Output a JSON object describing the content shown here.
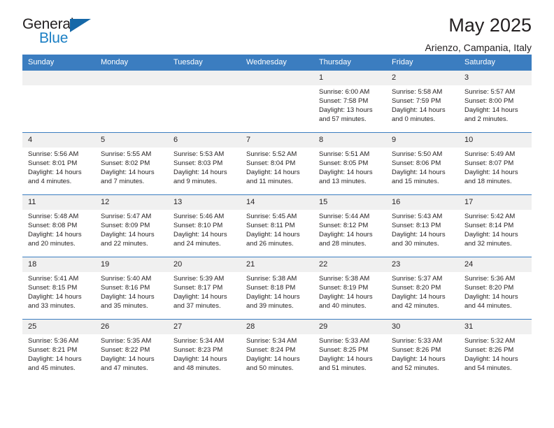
{
  "brand": {
    "name_top": "General",
    "name_bottom": "Blue",
    "accent_color": "#1b7fc4",
    "triangle_color": "#1568a8"
  },
  "header": {
    "title": "May 2025",
    "subtitle": "Arienzo, Campania, Italy"
  },
  "theme": {
    "header_row_bg": "#3b7dc0",
    "daynum_bg": "#f0f0f0",
    "text_color": "#231f20"
  },
  "weekdays": [
    "Sunday",
    "Monday",
    "Tuesday",
    "Wednesday",
    "Thursday",
    "Friday",
    "Saturday"
  ],
  "labels": {
    "sunrise_prefix": "Sunrise:",
    "sunset_prefix": "Sunset:",
    "daylight_prefix": "Daylight:"
  },
  "weeks": [
    [
      {
        "day": "",
        "empty": true
      },
      {
        "day": "",
        "empty": true
      },
      {
        "day": "",
        "empty": true
      },
      {
        "day": "",
        "empty": true
      },
      {
        "day": "1",
        "sunrise": "Sunrise: 6:00 AM",
        "sunset": "Sunset: 7:58 PM",
        "daylight": "Daylight: 13 hours and 57 minutes."
      },
      {
        "day": "2",
        "sunrise": "Sunrise: 5:58 AM",
        "sunset": "Sunset: 7:59 PM",
        "daylight": "Daylight: 14 hours and 0 minutes."
      },
      {
        "day": "3",
        "sunrise": "Sunrise: 5:57 AM",
        "sunset": "Sunset: 8:00 PM",
        "daylight": "Daylight: 14 hours and 2 minutes."
      }
    ],
    [
      {
        "day": "4",
        "sunrise": "Sunrise: 5:56 AM",
        "sunset": "Sunset: 8:01 PM",
        "daylight": "Daylight: 14 hours and 4 minutes."
      },
      {
        "day": "5",
        "sunrise": "Sunrise: 5:55 AM",
        "sunset": "Sunset: 8:02 PM",
        "daylight": "Daylight: 14 hours and 7 minutes."
      },
      {
        "day": "6",
        "sunrise": "Sunrise: 5:53 AM",
        "sunset": "Sunset: 8:03 PM",
        "daylight": "Daylight: 14 hours and 9 minutes."
      },
      {
        "day": "7",
        "sunrise": "Sunrise: 5:52 AM",
        "sunset": "Sunset: 8:04 PM",
        "daylight": "Daylight: 14 hours and 11 minutes."
      },
      {
        "day": "8",
        "sunrise": "Sunrise: 5:51 AM",
        "sunset": "Sunset: 8:05 PM",
        "daylight": "Daylight: 14 hours and 13 minutes."
      },
      {
        "day": "9",
        "sunrise": "Sunrise: 5:50 AM",
        "sunset": "Sunset: 8:06 PM",
        "daylight": "Daylight: 14 hours and 15 minutes."
      },
      {
        "day": "10",
        "sunrise": "Sunrise: 5:49 AM",
        "sunset": "Sunset: 8:07 PM",
        "daylight": "Daylight: 14 hours and 18 minutes."
      }
    ],
    [
      {
        "day": "11",
        "sunrise": "Sunrise: 5:48 AM",
        "sunset": "Sunset: 8:08 PM",
        "daylight": "Daylight: 14 hours and 20 minutes."
      },
      {
        "day": "12",
        "sunrise": "Sunrise: 5:47 AM",
        "sunset": "Sunset: 8:09 PM",
        "daylight": "Daylight: 14 hours and 22 minutes."
      },
      {
        "day": "13",
        "sunrise": "Sunrise: 5:46 AM",
        "sunset": "Sunset: 8:10 PM",
        "daylight": "Daylight: 14 hours and 24 minutes."
      },
      {
        "day": "14",
        "sunrise": "Sunrise: 5:45 AM",
        "sunset": "Sunset: 8:11 PM",
        "daylight": "Daylight: 14 hours and 26 minutes."
      },
      {
        "day": "15",
        "sunrise": "Sunrise: 5:44 AM",
        "sunset": "Sunset: 8:12 PM",
        "daylight": "Daylight: 14 hours and 28 minutes."
      },
      {
        "day": "16",
        "sunrise": "Sunrise: 5:43 AM",
        "sunset": "Sunset: 8:13 PM",
        "daylight": "Daylight: 14 hours and 30 minutes."
      },
      {
        "day": "17",
        "sunrise": "Sunrise: 5:42 AM",
        "sunset": "Sunset: 8:14 PM",
        "daylight": "Daylight: 14 hours and 32 minutes."
      }
    ],
    [
      {
        "day": "18",
        "sunrise": "Sunrise: 5:41 AM",
        "sunset": "Sunset: 8:15 PM",
        "daylight": "Daylight: 14 hours and 33 minutes."
      },
      {
        "day": "19",
        "sunrise": "Sunrise: 5:40 AM",
        "sunset": "Sunset: 8:16 PM",
        "daylight": "Daylight: 14 hours and 35 minutes."
      },
      {
        "day": "20",
        "sunrise": "Sunrise: 5:39 AM",
        "sunset": "Sunset: 8:17 PM",
        "daylight": "Daylight: 14 hours and 37 minutes."
      },
      {
        "day": "21",
        "sunrise": "Sunrise: 5:38 AM",
        "sunset": "Sunset: 8:18 PM",
        "daylight": "Daylight: 14 hours and 39 minutes."
      },
      {
        "day": "22",
        "sunrise": "Sunrise: 5:38 AM",
        "sunset": "Sunset: 8:19 PM",
        "daylight": "Daylight: 14 hours and 40 minutes."
      },
      {
        "day": "23",
        "sunrise": "Sunrise: 5:37 AM",
        "sunset": "Sunset: 8:20 PM",
        "daylight": "Daylight: 14 hours and 42 minutes."
      },
      {
        "day": "24",
        "sunrise": "Sunrise: 5:36 AM",
        "sunset": "Sunset: 8:20 PM",
        "daylight": "Daylight: 14 hours and 44 minutes."
      }
    ],
    [
      {
        "day": "25",
        "sunrise": "Sunrise: 5:36 AM",
        "sunset": "Sunset: 8:21 PM",
        "daylight": "Daylight: 14 hours and 45 minutes."
      },
      {
        "day": "26",
        "sunrise": "Sunrise: 5:35 AM",
        "sunset": "Sunset: 8:22 PM",
        "daylight": "Daylight: 14 hours and 47 minutes."
      },
      {
        "day": "27",
        "sunrise": "Sunrise: 5:34 AM",
        "sunset": "Sunset: 8:23 PM",
        "daylight": "Daylight: 14 hours and 48 minutes."
      },
      {
        "day": "28",
        "sunrise": "Sunrise: 5:34 AM",
        "sunset": "Sunset: 8:24 PM",
        "daylight": "Daylight: 14 hours and 50 minutes."
      },
      {
        "day": "29",
        "sunrise": "Sunrise: 5:33 AM",
        "sunset": "Sunset: 8:25 PM",
        "daylight": "Daylight: 14 hours and 51 minutes."
      },
      {
        "day": "30",
        "sunrise": "Sunrise: 5:33 AM",
        "sunset": "Sunset: 8:26 PM",
        "daylight": "Daylight: 14 hours and 52 minutes."
      },
      {
        "day": "31",
        "sunrise": "Sunrise: 5:32 AM",
        "sunset": "Sunset: 8:26 PM",
        "daylight": "Daylight: 14 hours and 54 minutes."
      }
    ]
  ]
}
